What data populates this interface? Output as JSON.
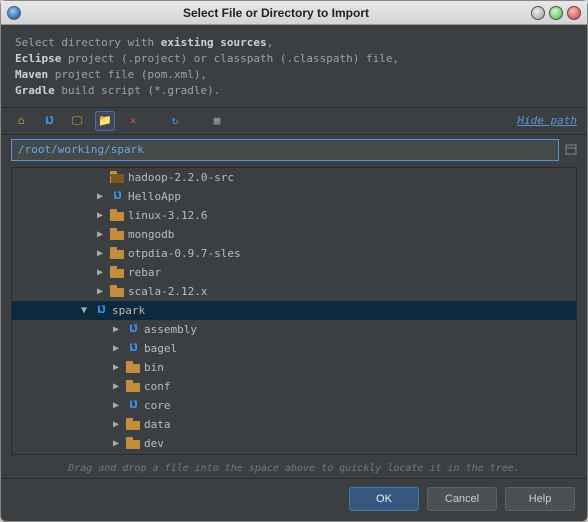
{
  "window": {
    "title": "Select File or Directory to Import"
  },
  "instruction": {
    "line1_a": "Select directory with ",
    "line1_b": "existing sources",
    "line1_c": ",",
    "line2_a": "Eclipse",
    "line2_b": " project (.project) or classpath (.classpath) file,",
    "line3_a": "Maven",
    "line3_b": " project file (pom.xml),",
    "line4_a": "Gradle",
    "line4_b": " build script (*.gradle)."
  },
  "toolbar": {
    "home": "home-icon",
    "project": "project-icon",
    "desktop": "desktop-icon",
    "newfolder": "new-folder-icon",
    "delete": "delete-icon",
    "refresh": "refresh-icon",
    "showhidden": "show-hidden-icon",
    "hide_path": "Hide path"
  },
  "path": {
    "value": "/root/working/spark"
  },
  "tree": [
    {
      "indent": 74,
      "arrow": "",
      "icon": "folder-open",
      "label": "hadoop-2.2.0-src"
    },
    {
      "indent": 74,
      "arrow": "▶",
      "icon": "ij",
      "label": "HelloApp"
    },
    {
      "indent": 74,
      "arrow": "▶",
      "icon": "folder",
      "label": "linux-3.12.6"
    },
    {
      "indent": 74,
      "arrow": "▶",
      "icon": "folder",
      "label": "mongodb"
    },
    {
      "indent": 74,
      "arrow": "▶",
      "icon": "folder",
      "label": "otpdia-0.9.7-sles"
    },
    {
      "indent": 74,
      "arrow": "▶",
      "icon": "folder",
      "label": "rebar"
    },
    {
      "indent": 74,
      "arrow": "▶",
      "icon": "folder",
      "label": "scala-2.12.x"
    },
    {
      "indent": 58,
      "arrow": "▼",
      "icon": "ij",
      "label": "spark",
      "selected": true
    },
    {
      "indent": 90,
      "arrow": "▶",
      "icon": "ij",
      "label": "assembly"
    },
    {
      "indent": 90,
      "arrow": "▶",
      "icon": "ij",
      "label": "bagel"
    },
    {
      "indent": 90,
      "arrow": "▶",
      "icon": "folder",
      "label": "bin"
    },
    {
      "indent": 90,
      "arrow": "▶",
      "icon": "folder",
      "label": "conf"
    },
    {
      "indent": 90,
      "arrow": "▶",
      "icon": "ij",
      "label": "core"
    },
    {
      "indent": 90,
      "arrow": "▶",
      "icon": "folder",
      "label": "data"
    },
    {
      "indent": 90,
      "arrow": "▶",
      "icon": "folder",
      "label": "dev"
    }
  ],
  "hint": "Drag and drop a file into the space above to quickly locate it in the tree.",
  "footer": {
    "ok": "OK",
    "cancel": "Cancel",
    "help": "Help"
  }
}
